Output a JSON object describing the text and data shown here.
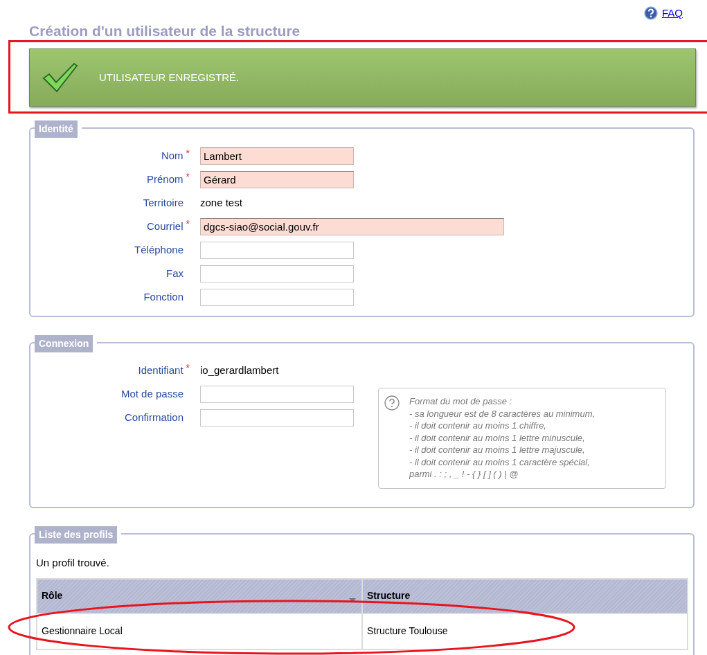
{
  "faq_link": "FAQ",
  "title": "Création d'un utilisateur de la structure",
  "banner": {
    "message": "UTILISATEUR ENREGISTRÉ."
  },
  "identity": {
    "legend": "Identité",
    "fields": [
      {
        "label": "Nom",
        "marker": "*",
        "kind": "input",
        "highlighted": true,
        "value": "Lambert"
      },
      {
        "label": "Prénom",
        "marker": "*",
        "kind": "input",
        "highlighted": true,
        "value": "Gérard"
      },
      {
        "label": "Territoire",
        "kind": "text",
        "value": "zone test"
      },
      {
        "label": "Courriel",
        "marker": "*",
        "kind": "wide_input",
        "highlighted": true,
        "value": "dgcs-siao@social.gouv.fr"
      },
      {
        "label": "Téléphone",
        "kind": "input",
        "highlighted": false
      },
      {
        "label": "Fax",
        "kind": "input",
        "highlighted": false
      },
      {
        "label": "Fonction",
        "kind": "input",
        "highlighted": false
      }
    ]
  },
  "connection": {
    "legend": "Connexion",
    "fields": [
      {
        "label": "Identifiant",
        "marker": "*",
        "kind": "text",
        "value": "io_gerardlambert"
      },
      {
        "label": "Mot de passe",
        "kind": "input",
        "highlighted": false
      },
      {
        "label": "Confirmation",
        "kind": "input",
        "highlighted": false
      }
    ],
    "help": [
      "Format du mot de passe :",
      "- sa longueur est de 8 caractères au minimum,",
      "- il doit contenir au moins 1 chiffre,",
      "- il doit contenir au moins 1 lettre minuscule,",
      "- il doit contenir au moins 1 lettre majuscule,",
      "- il doit contenir au moins 1 caractère spécial,",
      "parmi . : ; , _ ! - { } [ ] ( ) | @"
    ]
  },
  "profiles": {
    "legend": "Liste des profils",
    "count_text": "Un profil trouvé.",
    "columns": [
      "Rôle",
      "Structure"
    ],
    "rows": [
      [
        "Gestionnaire Local",
        "Structure Toulouse"
      ]
    ]
  }
}
